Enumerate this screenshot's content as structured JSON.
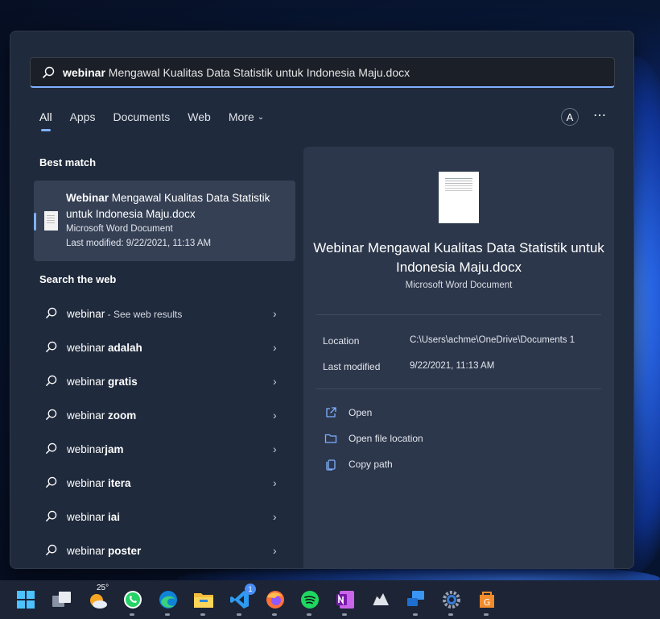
{
  "search": {
    "query": "webinar",
    "rest": " Mengawal Kualitas Data Statistik untuk Indonesia Maju.docx"
  },
  "tabs": [
    {
      "label": "All"
    },
    {
      "label": "Apps"
    },
    {
      "label": "Documents"
    },
    {
      "label": "Web"
    },
    {
      "label": "More"
    }
  ],
  "account_initial": "A",
  "more_menu": "⋯",
  "best_match": {
    "heading": "Best match",
    "title_bold": "Webinar",
    "title_rest": " Mengawal Kualitas Data Statistik untuk Indonesia Maju.docx",
    "type": "Microsoft Word Document",
    "modified": "Last modified: 9/22/2021, 11:13 AM"
  },
  "web": {
    "heading": "Search the web",
    "items": [
      {
        "prefix": "webinar",
        "bold": "",
        "suffix": " - See web results"
      },
      {
        "prefix": "webinar ",
        "bold": "adalah",
        "suffix": ""
      },
      {
        "prefix": "webinar ",
        "bold": "gratis",
        "suffix": ""
      },
      {
        "prefix": "webinar ",
        "bold": "zoom",
        "suffix": ""
      },
      {
        "prefix": "webinar",
        "bold": "jam",
        "suffix": ""
      },
      {
        "prefix": "webinar ",
        "bold": "itera",
        "suffix": ""
      },
      {
        "prefix": "webinar ",
        "bold": "iai",
        "suffix": ""
      },
      {
        "prefix": "webinar ",
        "bold": "poster",
        "suffix": ""
      }
    ]
  },
  "detail": {
    "title": "Webinar Mengawal Kualitas Data Statistik untuk Indonesia Maju.docx",
    "type": "Microsoft Word Document",
    "location_label": "Location",
    "location_value": "C:\\Users\\achme\\OneDrive\\Documents 1",
    "modified_label": "Last modified",
    "modified_value": "9/22/2021, 11:13 AM",
    "actions": [
      {
        "label": "Open",
        "icon": "open-external-icon"
      },
      {
        "label": "Open file location",
        "icon": "folder-icon"
      },
      {
        "label": "Copy path",
        "icon": "copy-icon"
      }
    ]
  },
  "taskbar": {
    "weather_temp": "25°",
    "badge_count": "1",
    "apps": [
      "start-icon",
      "task-view-icon",
      "weather-icon",
      "whatsapp-icon",
      "edge-icon",
      "file-explorer-icon",
      "vscode-icon",
      "firefox-icon",
      "spotify-icon",
      "onenote-icon",
      "gaming-icon",
      "remote-desktop-icon",
      "settings-icon",
      "app-icon"
    ]
  },
  "colors": {
    "accent": "#7fb0ff",
    "panel": "#1f2a3c",
    "detail_panel": "#2c374b"
  }
}
